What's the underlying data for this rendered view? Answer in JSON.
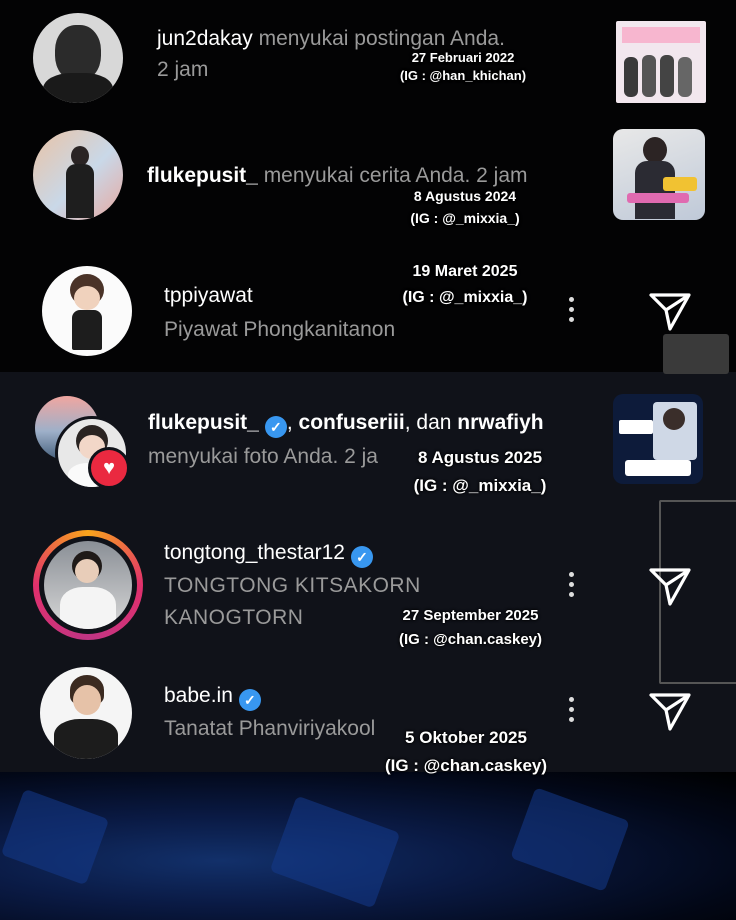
{
  "notifications": [
    {
      "username": "jun2dakay",
      "action": " menyukai postingan Anda.",
      "time": "2 jam",
      "stamp_date": "27 Februari 2022",
      "stamp_handle": "(IG : @han_khichan)"
    },
    {
      "username": "flukepusit_",
      "action": " menyukai cerita Anda.",
      "time": " 2 jam",
      "stamp_date": "8 Agustus 2024",
      "stamp_handle": "(IG : @_mixxia_)"
    },
    {
      "username": "fluke­pusit_",
      "user2": "confuseriii",
      "conj": ", ",
      "dan": ", dan ",
      "user3": "nrwafiyh",
      "action": "menyukai foto Anda. 2 ja",
      "stamp_date": "8 Agustus 2025",
      "stamp_handle": "(IG : @_mixxia_)"
    }
  ],
  "suggestions": [
    {
      "username": "tppiyawat",
      "fullname": "Piyawat Phongkanitanon",
      "stamp_date": "19 Maret 2025",
      "stamp_handle": "(IG : @_mixxia_)"
    },
    {
      "username": "tongtong_thestar12",
      "fullname_line1": "TONGTONG KITSAKORN",
      "fullname_line2": "KANOGTORN",
      "stamp_date": "27 September 2025",
      "stamp_handle": "(IG : @chan.caskey)"
    },
    {
      "username": "babe.in",
      "fullname": "Tanatat Phanviriyakool",
      "stamp_date": "5 Oktober 2025",
      "stamp_handle": "(IG : @chan.caskey)"
    }
  ],
  "icons": {
    "verified": "✓",
    "heart": "♥",
    "send": "paper-plane-icon",
    "more": "more-vertical-icon"
  },
  "colors": {
    "verified_blue": "#3897f0",
    "heart_red": "#ea2940",
    "muted_text": "#9a9a9a"
  }
}
